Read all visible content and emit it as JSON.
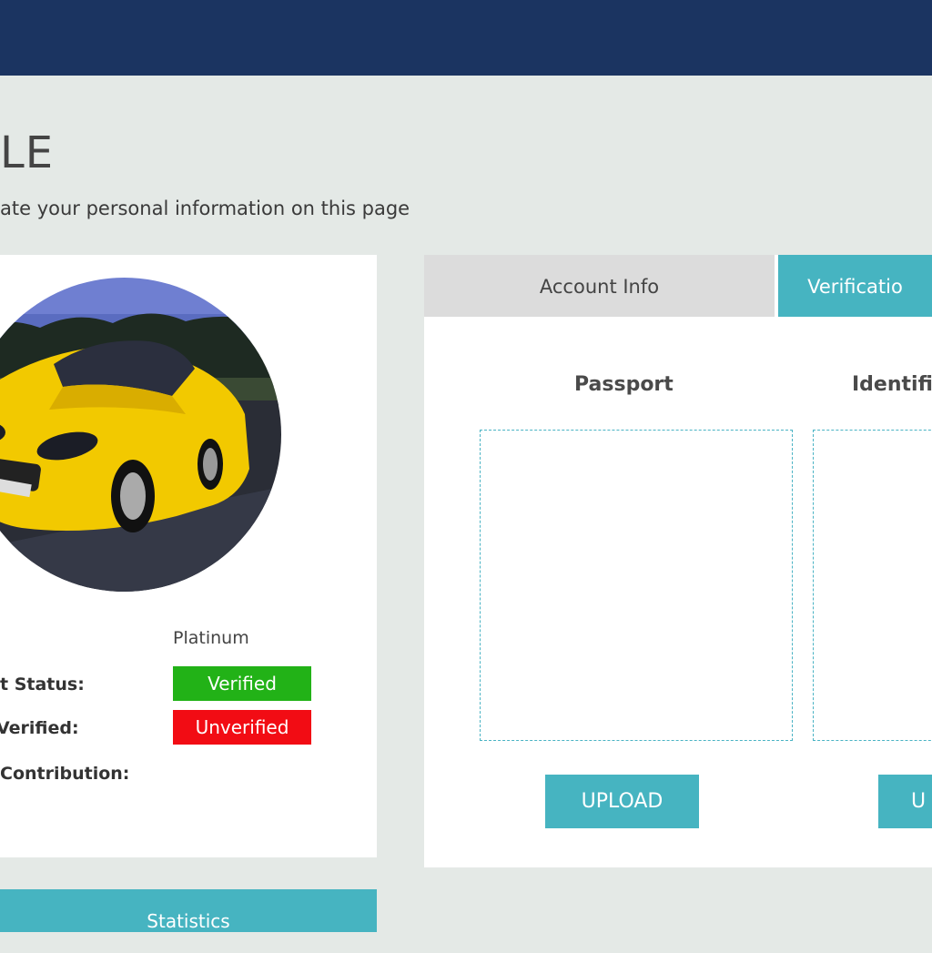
{
  "colors": {
    "header_bg": "#1b3461",
    "page_bg": "#e4e9e6",
    "accent": "#46b4c1",
    "verified": "#22b217",
    "unverified": "#f20c14",
    "tab_inactive": "#dcdcdc"
  },
  "page": {
    "title": "LE",
    "subtitle": "ate your personal information on this page"
  },
  "profile": {
    "avatar_icon": "car-photo",
    "rows": [
      {
        "label": "",
        "value": "Platinum"
      },
      {
        "label": "t Status:",
        "value": "Verified"
      },
      {
        "label": "Verified:",
        "value": "Unverified"
      },
      {
        "label": " Contribution:",
        "value": ""
      }
    ]
  },
  "statistics_tab": {
    "label": "Statistics"
  },
  "tabs": [
    {
      "label": "Account Info"
    },
    {
      "label": "Verificatio"
    }
  ],
  "documents": [
    {
      "title": "Passport",
      "button": "UPLOAD"
    },
    {
      "title": "Identifi",
      "button": "U"
    }
  ]
}
